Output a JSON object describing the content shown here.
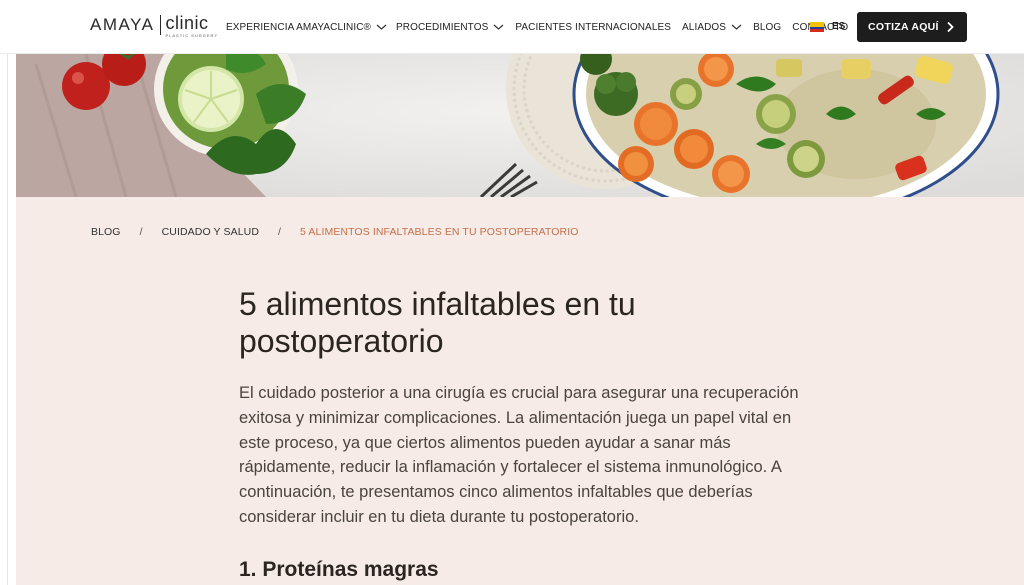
{
  "brand": {
    "name": "AMAYA",
    "name2": "clinic",
    "tagline": "PLASTIC SURGERY"
  },
  "nav": {
    "items": [
      {
        "label": "EXPERIENCIA AMAYACLINIC®",
        "has_dropdown": true
      },
      {
        "label": "PROCEDIMIENTOS",
        "has_dropdown": true
      },
      {
        "label": "PACIENTES INTERNACIONALES",
        "has_dropdown": false
      },
      {
        "label": "ALIADOS",
        "has_dropdown": true
      },
      {
        "label": "BLOG",
        "has_dropdown": false
      },
      {
        "label": "CONTACTO",
        "has_dropdown": false
      }
    ],
    "language": "ES",
    "cta_label": "COTIZA AQUÍ"
  },
  "breadcrumb": {
    "items": [
      "BLOG",
      "CUIDADO Y SALUD"
    ],
    "separator": "/",
    "current": "5 ALIMENTOS INFALTABLES EN TU POSTOPERATORIO"
  },
  "article": {
    "title": "5 alimentos infaltables en tu postoperatorio",
    "intro": "El cuidado posterior a una cirugía es crucial para asegurar una recuperación exitosa y minimizar complicaciones. La alimentación juega un papel vital en este proceso, ya que ciertos alimentos pueden ayudar a sanar más rápidamente, reducir la inflamación y fortalecer el sistema inmunológico. A continuación, te presentamos cinco alimentos infaltables que deberías considerar incluir en tu dieta durante tu postoperatorio.",
    "subhead": "1. Proteínas magras"
  },
  "colors": {
    "accent": "#c4704a",
    "cta_bg": "#1d1d1d",
    "content_bg": "#f6ebe7",
    "text_dark": "#2b2522"
  },
  "icons": {
    "dropdown": "chevron-down-icon",
    "cta": "chevron-right-icon",
    "flag": "colombia-flag-icon"
  }
}
